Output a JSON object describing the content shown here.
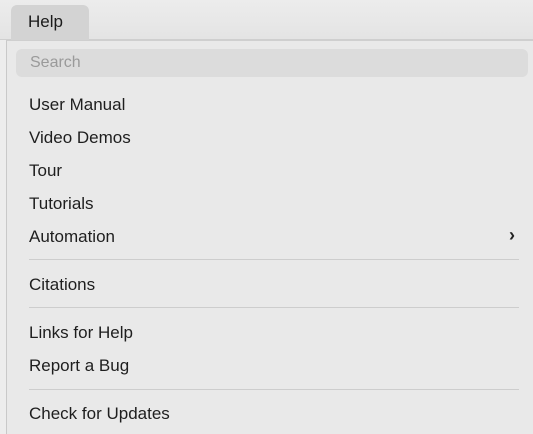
{
  "menubar": {
    "help_label": "Help"
  },
  "menu": {
    "search_placeholder": "Search",
    "group1": {
      "user_manual": "User Manual",
      "video_demos": "Video Demos",
      "tour": "Tour",
      "tutorials": "Tutorials",
      "automation": "Automation",
      "automation_chevron": "›"
    },
    "group2": {
      "citations": "Citations"
    },
    "group3": {
      "links_for_help": "Links for Help",
      "report_a_bug": "Report a Bug"
    },
    "group4": {
      "check_for_updates": "Check for Updates"
    }
  }
}
